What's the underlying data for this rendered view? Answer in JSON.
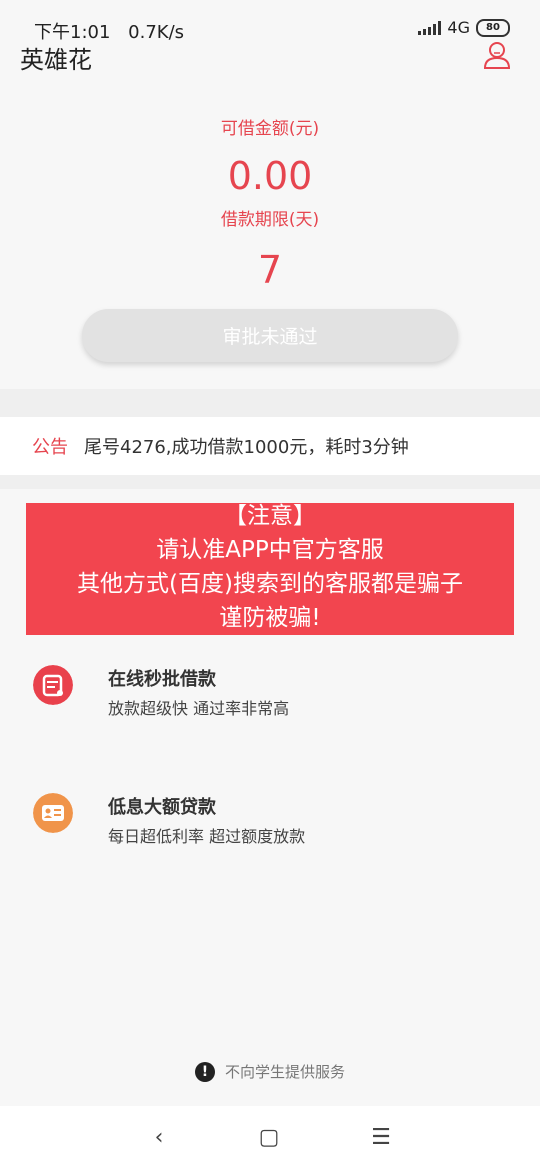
{
  "status_bar": {
    "time": "下午1:01",
    "speed": "0.7K/s",
    "network": "4G",
    "battery": "80"
  },
  "header": {
    "title": "英雄花",
    "user_icon": "user-icon"
  },
  "loan": {
    "amount_label": "可借金额(元)",
    "amount_value": "0.00",
    "term_label": "借款期限(天)",
    "term_value": "7",
    "button_label": "审批未通过"
  },
  "notice": {
    "tag": "公告",
    "text": "尾号4276,成功借款1000元，耗时3分钟"
  },
  "warning": {
    "line1": "【注意】",
    "line2": "请认准APP中官方客服",
    "line3": "其他方式(百度)搜索到的客服都是骗子",
    "line4": "谨防被骗!"
  },
  "features": [
    {
      "title": "在线秒批借款",
      "desc": "放款超级快  通过率非常高",
      "icon": "document-icon",
      "color": "#e9414c"
    },
    {
      "title": "低息大额贷款",
      "desc": "每日超低利率   超过额度放款",
      "icon": "id-card-icon",
      "color": "#f0944a"
    }
  ],
  "footer": {
    "note": "不向学生提供服务"
  },
  "nav": {
    "back": "‹",
    "home": "▢",
    "menu": "☰"
  },
  "colors": {
    "accent": "#e6454f",
    "banner": "#f2454f",
    "button": "#e2e2e2"
  }
}
